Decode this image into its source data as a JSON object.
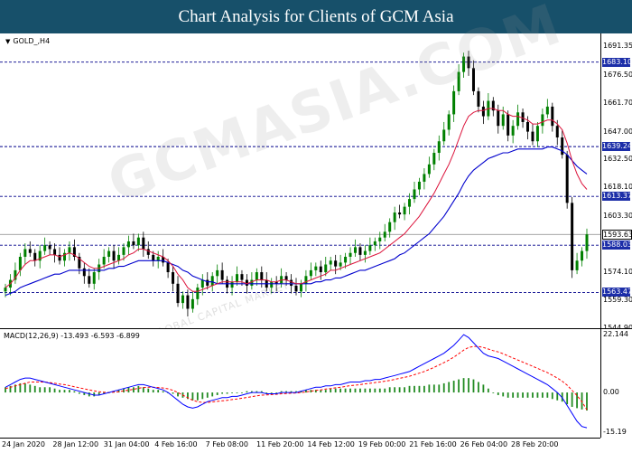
{
  "header": {
    "title": "Chart Analysis for Clients of GCM Asia"
  },
  "symbol": {
    "name": "GOLD_,H4",
    "collapse_icon": "triangle-down-icon"
  },
  "macd": {
    "label": "MACD(12,26,9) -13.493 -6.593 -6.899"
  },
  "watermark": {
    "text": "GCMASIA.COM",
    "sub": "© GLOBAL CAPITAL MARKETS"
  },
  "colors": {
    "bull": "#008000",
    "bear": "#000000",
    "fast_ma": "#dc143c",
    "slow_ma": "#0000cd",
    "level_line": "#00008b",
    "tag_bg": "#1c2ea8",
    "macd_hist": "#228b22",
    "macd_signal": "#ff0000",
    "macd_line": "#0000ff"
  },
  "chart_data": {
    "type": "candlestick",
    "symbol": "GOLD_,H4",
    "ylim": [
      1544.9,
      1698
    ],
    "price_ticks": [
      "1691.35",
      "1676.50",
      "1661.70",
      "1647.00",
      "1632.50",
      "1618.10",
      "1603.30",
      "1574.10",
      "1559.30",
      "1544.90"
    ],
    "levels": [
      1683.1,
      1639.24,
      1613.37,
      1588.03,
      1563.47
    ],
    "level_labels": [
      "1683.10",
      "1639.24",
      "1613.37",
      "1588.03",
      "1563.47"
    ],
    "current_price": 1593.63,
    "current_price_label": "1593.63",
    "x_labels": [
      "24 Jan 2020",
      "28 Jan 12:00",
      "31 Jan 04:00",
      "4 Feb 16:00",
      "7 Feb 08:00",
      "11 Feb 20:00",
      "14 Feb 12:00",
      "19 Feb 00:00",
      "21 Feb 16:00",
      "26 Feb 04:00",
      "28 Feb 20:00"
    ],
    "closes": [
      1566,
      1570,
      1575,
      1582,
      1586,
      1584,
      1580,
      1585,
      1588,
      1586,
      1583,
      1580,
      1584,
      1587,
      1582,
      1576,
      1572,
      1568,
      1574,
      1578,
      1582,
      1585,
      1580,
      1583,
      1587,
      1590,
      1588,
      1592,
      1586,
      1583,
      1580,
      1582,
      1579,
      1574,
      1568,
      1558,
      1562,
      1555,
      1560,
      1566,
      1570,
      1567,
      1572,
      1575,
      1570,
      1566,
      1569,
      1573,
      1570,
      1567,
      1570,
      1574,
      1570,
      1566,
      1569,
      1568,
      1572,
      1570,
      1567,
      1564,
      1568,
      1572,
      1575,
      1577,
      1574,
      1578,
      1580,
      1577,
      1579,
      1582,
      1584,
      1587,
      1583,
      1585,
      1588,
      1590,
      1592,
      1595,
      1600,
      1605,
      1604,
      1608,
      1612,
      1617,
      1621,
      1625,
      1630,
      1636,
      1642,
      1648,
      1656,
      1668,
      1678,
      1686,
      1680,
      1668,
      1660,
      1655,
      1663,
      1658,
      1650,
      1656,
      1645,
      1650,
      1657,
      1652,
      1647,
      1642,
      1650,
      1656,
      1660,
      1650,
      1644,
      1635,
      1610,
      1575,
      1580,
      1585,
      1593.63
    ],
    "fast_ma": [
      1566,
      1568,
      1571,
      1575,
      1578,
      1580,
      1580,
      1581,
      1582,
      1583,
      1583,
      1582,
      1583,
      1584,
      1583,
      1581,
      1579,
      1577,
      1576,
      1576,
      1577,
      1578,
      1579,
      1580,
      1581,
      1583,
      1584,
      1586,
      1586,
      1585,
      1584,
      1583,
      1582,
      1580,
      1577,
      1573,
      1570,
      1566,
      1564,
      1564,
      1565,
      1566,
      1567,
      1568,
      1569,
      1569,
      1569,
      1569,
      1569,
      1568,
      1569,
      1570,
      1570,
      1570,
      1569,
      1569,
      1570,
      1570,
      1569,
      1568,
      1568,
      1569,
      1570,
      1571,
      1572,
      1573,
      1575,
      1575,
      1576,
      1577,
      1578,
      1579,
      1580,
      1581,
      1582,
      1583,
      1584,
      1586,
      1588,
      1590,
      1592,
      1594,
      1597,
      1600,
      1603,
      1607,
      1611,
      1615,
      1620,
      1625,
      1630,
      1636,
      1643,
      1650,
      1655,
      1657,
      1658,
      1658,
      1659,
      1659,
      1658,
      1658,
      1656,
      1655,
      1655,
      1654,
      1653,
      1651,
      1651,
      1652,
      1653,
      1653,
      1651,
      1648,
      1641,
      1632,
      1625,
      1620,
      1617
    ],
    "slow_ma": [
      1562,
      1563,
      1564,
      1566,
      1567,
      1568,
      1569,
      1570,
      1571,
      1572,
      1573,
      1573,
      1574,
      1575,
      1575,
      1575,
      1575,
      1575,
      1575,
      1575,
      1575,
      1576,
      1576,
      1577,
      1577,
      1578,
      1579,
      1580,
      1580,
      1580,
      1580,
      1580,
      1580,
      1579,
      1578,
      1577,
      1575,
      1574,
      1572,
      1571,
      1570,
      1569,
      1569,
      1568,
      1568,
      1568,
      1568,
      1568,
      1568,
      1568,
      1568,
      1568,
      1568,
      1568,
      1568,
      1568,
      1568,
      1568,
      1568,
      1568,
      1568,
      1568,
      1568,
      1569,
      1569,
      1570,
      1570,
      1571,
      1571,
      1572,
      1573,
      1574,
      1575,
      1575,
      1576,
      1577,
      1578,
      1579,
      1580,
      1581,
      1583,
      1584,
      1586,
      1588,
      1590,
      1592,
      1594,
      1597,
      1600,
      1603,
      1607,
      1611,
      1615,
      1620,
      1624,
      1627,
      1629,
      1631,
      1633,
      1634,
      1635,
      1636,
      1636,
      1637,
      1638,
      1638,
      1638,
      1638,
      1638,
      1638,
      1639,
      1639,
      1638,
      1637,
      1635,
      1632,
      1629,
      1627,
      1625
    ],
    "macd_ylim": [
      -15.19,
      22.144
    ],
    "macd_ticks": [
      "22.144",
      "0.00",
      "-15.19"
    ],
    "macd_hist": [
      2,
      2.5,
      3,
      3.5,
      3.5,
      3,
      2.5,
      2,
      2,
      2,
      1.5,
      1,
      1,
      1,
      0.5,
      -0.5,
      -1,
      -1.5,
      -1.5,
      -1,
      -0.5,
      0,
      0.5,
      1,
      1.5,
      2,
      2,
      2.5,
      2,
      1.5,
      1,
      1,
      0.5,
      0,
      -0.5,
      -1.5,
      -2,
      -2.5,
      -3,
      -3,
      -2.5,
      -2,
      -1.5,
      -1,
      -0.5,
      -0.5,
      0,
      0,
      0,
      0.5,
      0.5,
      0.5,
      0.5,
      0,
      0,
      0,
      0.5,
      0.5,
      0.5,
      0.5,
      0.5,
      1,
      1,
      1,
      1,
      1,
      1.5,
      1.5,
      1.5,
      1.5,
      1.5,
      1.5,
      1.5,
      1.5,
      1.5,
      1.5,
      1.5,
      1.5,
      2,
      2,
      2,
      2,
      2.5,
      2.5,
      2.5,
      2.5,
      3,
      3,
      3,
      3.5,
      4,
      4.5,
      5,
      5.5,
      5.5,
      5,
      4,
      3,
      1.5,
      0,
      -1,
      -1.5,
      -2,
      -2,
      -2,
      -2,
      -2,
      -2,
      -2,
      -2,
      -2,
      -2.5,
      -3,
      -3.5,
      -4.5,
      -5.5,
      -6,
      -6.5,
      -6.9
    ],
    "macd_line": [
      2,
      3,
      4,
      5,
      5.5,
      5.5,
      5,
      4.5,
      4,
      3.5,
      3,
      2.5,
      2,
      1.5,
      1,
      0.5,
      0,
      -0.5,
      -1,
      -1,
      -0.5,
      0,
      0.5,
      1,
      1.5,
      2,
      2.5,
      3,
      3,
      2.5,
      2,
      1.5,
      1,
      0,
      -1.5,
      -3,
      -4.5,
      -5.5,
      -6,
      -5.5,
      -4.5,
      -3.5,
      -3,
      -2.5,
      -2,
      -2,
      -1.5,
      -1.5,
      -1,
      -0.5,
      0,
      0,
      0,
      -0.5,
      -0.5,
      -0.5,
      0,
      0,
      0,
      0,
      0.5,
      1,
      1.5,
      2,
      2,
      2.5,
      2.5,
      3,
      3,
      3.5,
      4,
      4,
      4,
      4.5,
      4.5,
      5,
      5,
      5.5,
      6,
      6.5,
      7,
      7.5,
      8,
      9,
      10,
      11,
      12,
      13,
      14,
      15,
      16.5,
      18,
      20,
      22.1,
      21,
      19,
      17,
      15,
      14,
      13.5,
      13,
      12,
      11,
      10,
      9,
      8,
      7,
      6,
      5,
      4,
      3,
      1.5,
      0,
      -2,
      -5,
      -8,
      -11,
      -13,
      -13.5
    ],
    "macd_signal": [
      1.5,
      2,
      2.5,
      3,
      3.5,
      4,
      4,
      4,
      4,
      3.8,
      3.5,
      3.2,
      3,
      2.6,
      2.2,
      1.8,
      1.4,
      1,
      0.6,
      0.3,
      0.1,
      0,
      0.1,
      0.3,
      0.6,
      0.9,
      1.2,
      1.6,
      1.9,
      2,
      2,
      1.9,
      1.7,
      1.4,
      0.8,
      0,
      -1,
      -2,
      -3,
      -3.5,
      -3.8,
      -3.8,
      -3.6,
      -3.4,
      -3.2,
      -3,
      -2.7,
      -2.5,
      -2.2,
      -1.9,
      -1.6,
      -1.3,
      -1,
      -0.9,
      -0.8,
      -0.7,
      -0.5,
      -0.4,
      -0.3,
      -0.2,
      0,
      0.2,
      0.5,
      0.8,
      1,
      1.3,
      1.5,
      1.8,
      2,
      2.3,
      2.6,
      2.8,
      3,
      3.3,
      3.5,
      3.8,
      4,
      4.3,
      4.6,
      5,
      5.4,
      5.8,
      6.2,
      6.8,
      7.4,
      8,
      8.8,
      9.6,
      10.5,
      11.4,
      12.4,
      13.5,
      14.8,
      16.2,
      17.2,
      17.6,
      17.6,
      17.2,
      16.6,
      16,
      15.5,
      14.8,
      14,
      13.2,
      12.4,
      11.6,
      10.8,
      10,
      9.2,
      8.4,
      7.6,
      6.6,
      5.5,
      4.3,
      2.8,
      0.8,
      -1.2,
      -3.5,
      -6.6
    ]
  }
}
